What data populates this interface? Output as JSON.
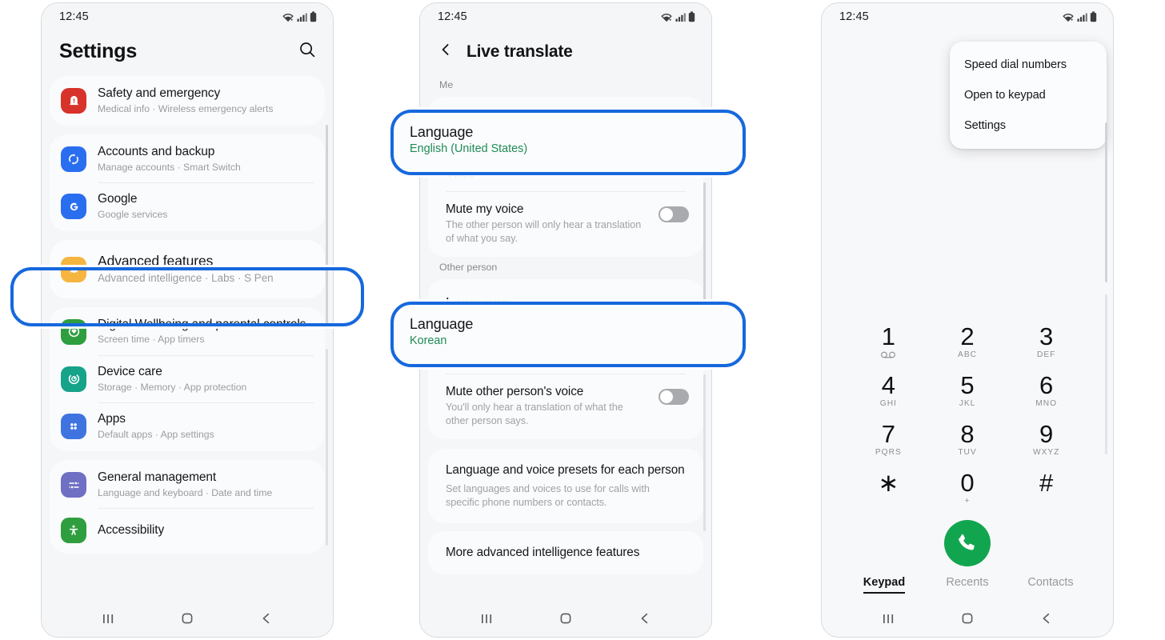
{
  "accent": {
    "highlight_blue": "#1668dd",
    "green_text": "#1f8a56",
    "call_green": "#12a550"
  },
  "phone1": {
    "status": {
      "time": "12:45"
    },
    "header": {
      "title": "Settings",
      "search_icon": "search-icon"
    },
    "groups": [
      {
        "rows": [
          {
            "title": "Safety and emergency",
            "subtitle": "Medical info  ·  Wireless emergency alerts",
            "icon": "safety-emergency-icon",
            "color": "#d7332a"
          }
        ]
      },
      {
        "rows": [
          {
            "title": "Accounts and backup",
            "subtitle": "Manage accounts  ·  Smart Switch",
            "icon": "accounts-backup-icon",
            "color": "#2a6ef0"
          },
          {
            "title": "Google",
            "subtitle": "Google services",
            "icon": "google-icon",
            "color": "#2a6ef0"
          }
        ]
      },
      {
        "rows": [
          {
            "title": "Advanced features",
            "subtitle": "Advanced intelligence  ·  Labs  ·  S Pen",
            "icon": "advanced-features-icon",
            "color": "#f5b53e",
            "highlighted": true
          }
        ]
      },
      {
        "rows": [
          {
            "title": "Digital Wellbeing and parental controls",
            "subtitle": "Screen time  ·  App timers",
            "icon": "digital-wellbeing-icon",
            "color": "#2f9e3f"
          },
          {
            "title": "Device care",
            "subtitle": "Storage  ·  Memory  ·  App protection",
            "icon": "device-care-icon",
            "color": "#15a38a"
          },
          {
            "title": "Apps",
            "subtitle": "Default apps  ·  App settings",
            "icon": "apps-icon",
            "color": "#3f74e0"
          }
        ]
      },
      {
        "rows": [
          {
            "title": "General management",
            "subtitle": "Language and keyboard  ·  Date and time",
            "icon": "general-management-icon",
            "color": "#6f6fc4"
          },
          {
            "title": "Accessibility",
            "subtitle": "",
            "icon": "accessibility-icon",
            "color": "#2f9e3f"
          }
        ]
      }
    ]
  },
  "phone2": {
    "status": {
      "time": "12:45"
    },
    "header": {
      "back_icon": "back-chevron-icon",
      "title": "Live translate"
    },
    "section_me": "Me",
    "me_language": {
      "title": "Language",
      "value": "English (United States)",
      "highlighted": true
    },
    "me_voice": {
      "title": "Voice"
    },
    "mute_my_voice": {
      "title": "Mute my voice",
      "subtitle": "The other person will only hear a translation of what you say.",
      "toggle_on": false
    },
    "section_other": "Other person",
    "other_language": {
      "title": "Language",
      "value": "Korean",
      "highlighted": true
    },
    "other_voice": {
      "title": "Voice"
    },
    "mute_other_voice": {
      "title": "Mute other person's voice",
      "subtitle": "You'll only hear a translation of what the other person says.",
      "toggle_on": false
    },
    "presets": {
      "title": "Language and voice presets for each person",
      "subtitle": "Set languages and voices to use for calls with specific phone numbers or contacts."
    },
    "more_features": {
      "title": "More advanced intelligence features"
    }
  },
  "phone3": {
    "status": {
      "time": "12:45"
    },
    "menu": {
      "items": [
        {
          "label": "Speed dial numbers"
        },
        {
          "label": "Open to keypad"
        },
        {
          "label": "Settings"
        }
      ]
    },
    "keypad": [
      [
        {
          "digit": "1",
          "letters": "voicemail-icon"
        },
        {
          "digit": "2",
          "letters": "ABC"
        },
        {
          "digit": "3",
          "letters": "DEF"
        }
      ],
      [
        {
          "digit": "4",
          "letters": "GHI"
        },
        {
          "digit": "5",
          "letters": "JKL"
        },
        {
          "digit": "6",
          "letters": "MNO"
        }
      ],
      [
        {
          "digit": "7",
          "letters": "PQRS"
        },
        {
          "digit": "8",
          "letters": "TUV"
        },
        {
          "digit": "9",
          "letters": "WXYZ"
        }
      ],
      [
        {
          "digit": "∗",
          "letters": ""
        },
        {
          "digit": "0",
          "letters": "+"
        },
        {
          "digit": "#",
          "letters": ""
        }
      ]
    ],
    "call_button": {
      "icon": "phone-call-icon"
    },
    "tabs": [
      {
        "label": "Keypad",
        "active": true
      },
      {
        "label": "Recents",
        "active": false
      },
      {
        "label": "Contacts",
        "active": false
      }
    ]
  },
  "navbar": {
    "recents_icon": "recents-icon",
    "home_icon": "home-icon",
    "back_icon": "back-icon"
  }
}
